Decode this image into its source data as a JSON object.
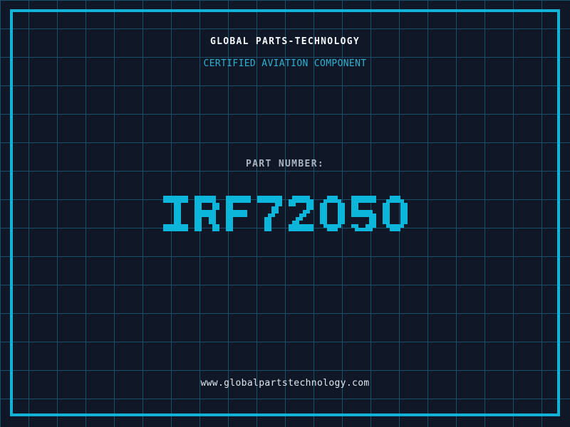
{
  "header": {
    "company": "GLOBAL PARTS-TECHNOLOGY",
    "certification": "CERTIFIED AVIATION COMPONENT"
  },
  "part": {
    "label": "PART NUMBER:",
    "value": "IRF72050"
  },
  "footer": {
    "website": "www.globalpartstechnology.com"
  },
  "colors": {
    "background": "#101828",
    "grid_line": "#1b4e6a",
    "frame_border": "#12b1d6",
    "part_number_text": "#0cb5da",
    "certification_text": "#2fb0d0",
    "label_text": "#a9b4c2",
    "company_text": "#f4f7fa",
    "website_text": "#dfe7ee"
  }
}
